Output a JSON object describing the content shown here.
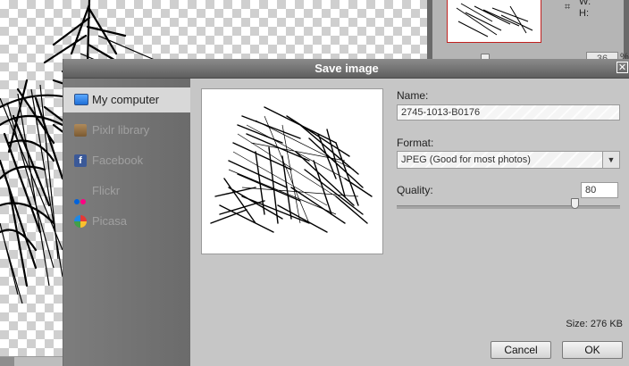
{
  "dialog": {
    "title": "Save image",
    "sidebar": [
      {
        "label": "My computer",
        "icon": "monitor-icon",
        "active": true
      },
      {
        "label": "Pixlr library",
        "icon": "library-box-icon",
        "active": false
      },
      {
        "label": "Facebook",
        "icon": "facebook-icon",
        "active": false
      },
      {
        "label": "Flickr",
        "icon": "flickr-icon",
        "active": false
      },
      {
        "label": "Picasa",
        "icon": "picasa-icon",
        "active": false
      }
    ],
    "name_label": "Name:",
    "name_value": "2745-1013-B0176",
    "format_label": "Format:",
    "format_value": "JPEG (Good for most photos)",
    "quality_label": "Quality:",
    "quality_value": "80",
    "size_text": "Size: 276 KB",
    "cancel_label": "Cancel",
    "ok_label": "OK"
  },
  "navigator": {
    "w_label": "W:",
    "h_label": "H:",
    "zoom_value": "36",
    "zoom_unit": "%"
  },
  "colors": {
    "facebook": "#3b5998",
    "flickr_pink": "#ff0084",
    "flickr_blue": "#0063dc",
    "selection_border": "#c0211f"
  }
}
